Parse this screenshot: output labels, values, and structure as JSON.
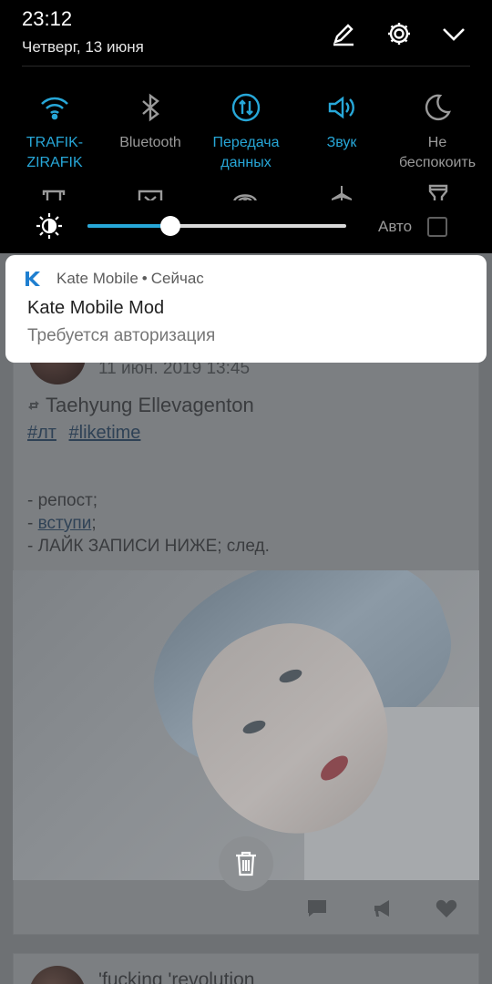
{
  "status": {
    "time": "23:12",
    "date": "Четверг, 13 июня"
  },
  "header": {
    "edit_icon": "pencil-edit-icon",
    "settings_icon": "gear-icon",
    "collapse_icon": "chevron-down-icon"
  },
  "quick_settings": {
    "tiles": [
      {
        "label": "TRAFIK-\nZIRAFIK",
        "icon": "wifi-icon",
        "active": true
      },
      {
        "label": "Bluetooth",
        "icon": "bluetooth-icon",
        "active": false
      },
      {
        "label": "Передача\nданных",
        "icon": "mobile-data-icon",
        "active": true
      },
      {
        "label": "Звук",
        "icon": "sound-icon",
        "active": true
      },
      {
        "label": "Не\nбеспокоить",
        "icon": "moon-icon",
        "active": false
      }
    ]
  },
  "brightness": {
    "level": 0.32,
    "auto_label": "Авто",
    "auto_checked": false
  },
  "notification": {
    "app": "Kate Mobile",
    "separator": "•",
    "time": "Сейчас",
    "title": "Kate Mobile Mod",
    "body": "Требуется авторизация"
  },
  "feed": {
    "post": {
      "date": "11 июн. 2019 13:45",
      "author": "Taehyung Ellevagenton",
      "tags": [
        "#лт",
        "#liketime"
      ],
      "line1": "- репост;",
      "line2_prefix": "- ",
      "line2_link": "вступи",
      "line2_suffix": ";",
      "line3": "- ЛАЙК ЗАПИСИ НИЖЕ; след."
    },
    "next_post_title": "'fucking 'revolution"
  },
  "colors": {
    "accent": "#27a7d8",
    "shade_bg": "#000000",
    "inactive": "#9a9a9a"
  }
}
